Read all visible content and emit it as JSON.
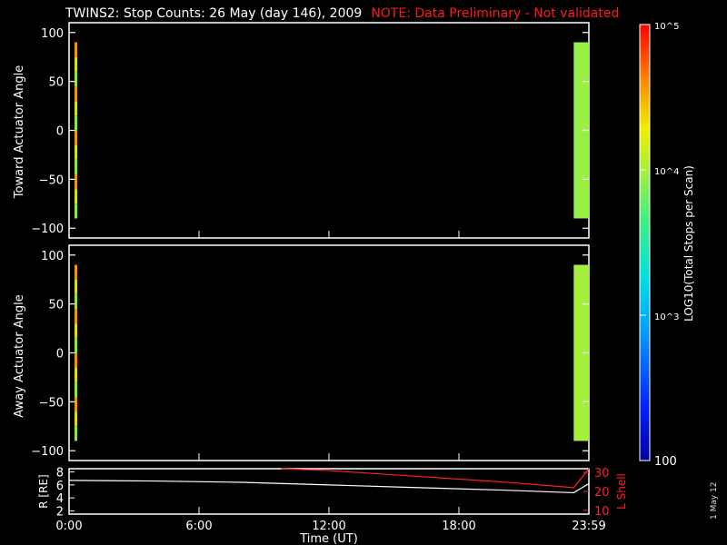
{
  "title": "TWINS2: Stop Counts: 26 May (day 146), 2009",
  "note": "NOTE: Data Preliminary - Not validated",
  "stamp": "1 May 12",
  "colorbar": {
    "label": "LOG10(Total Stops per Scan)",
    "ticks": [
      "100",
      "10^3",
      "10^4",
      "10^5"
    ]
  },
  "chart_data": [
    {
      "type": "heatmap",
      "panel": "top",
      "ylabel": "Toward Actuator Angle",
      "ylim": [
        -110,
        110
      ],
      "yticks": [
        -100,
        -50,
        0,
        50,
        100
      ],
      "xlim_hours": [
        0,
        24
      ],
      "xticks": [
        "0:00",
        "6:00",
        "12:00",
        "18:00",
        "23:59"
      ],
      "color_scale": "log",
      "zlim": [
        100,
        100000
      ],
      "blocks": [
        {
          "time_hours": [
            0.0,
            0.05
          ],
          "angle": [
            -90,
            90
          ],
          "level": 60000,
          "note": "thin strip near start"
        },
        {
          "time_hours": [
            23.3,
            24.0
          ],
          "angle": [
            -90,
            90
          ],
          "level": 9000
        }
      ]
    },
    {
      "type": "heatmap",
      "panel": "middle",
      "ylabel": "Away Actuator Angle",
      "ylim": [
        -110,
        110
      ],
      "yticks": [
        -100,
        -50,
        0,
        50,
        100
      ],
      "xlim_hours": [
        0,
        24
      ],
      "xticks": [
        "0:00",
        "6:00",
        "12:00",
        "18:00",
        "23:59"
      ],
      "color_scale": "log",
      "zlim": [
        100,
        100000
      ],
      "blocks": [
        {
          "time_hours": [
            0.0,
            0.05
          ],
          "angle": [
            -90,
            90
          ],
          "level": 60000
        },
        {
          "time_hours": [
            23.3,
            24.0
          ],
          "angle": [
            -90,
            90
          ],
          "level": 10000
        }
      ]
    },
    {
      "type": "line",
      "panel": "bottom",
      "xlabel": "Time (UT)",
      "ylabel_left": "R [RE]",
      "ylabel_right": "L Shell",
      "ylim_left": [
        1.5,
        8.5
      ],
      "ylim_right": [
        8,
        32
      ],
      "yticks_left": [
        2,
        4,
        6,
        8
      ],
      "yticks_right": [
        10,
        20,
        30
      ],
      "xticks": [
        "0:00",
        "6:00",
        "12:00",
        "18:00",
        "23:59"
      ],
      "series": [
        {
          "name": "R [RE]",
          "color": "#ffffff",
          "x": [
            0,
            4,
            8,
            12,
            16,
            20,
            23.3,
            24
          ],
          "y": [
            6.7,
            6.6,
            6.4,
            6.0,
            5.6,
            5.2,
            4.8,
            6.2
          ]
        },
        {
          "name": "L Shell",
          "color": "#ff2020",
          "x": [
            9.8,
            12,
            16,
            20,
            23.3,
            24
          ],
          "y": [
            32,
            31,
            28,
            25,
            22,
            32
          ]
        }
      ]
    }
  ]
}
